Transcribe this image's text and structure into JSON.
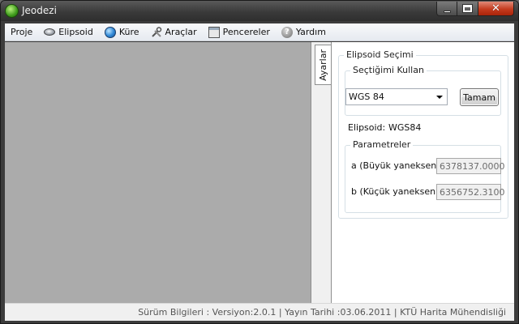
{
  "window": {
    "title": "Jeodezi"
  },
  "menu": {
    "items": [
      {
        "label": "Proje",
        "icon": ""
      },
      {
        "label": "Elipsoid",
        "icon": "ellipsoid-icon"
      },
      {
        "label": "Küre",
        "icon": "globe-icon"
      },
      {
        "label": "Araçlar",
        "icon": "tools-icon"
      },
      {
        "label": "Pencereler",
        "icon": "window-icon"
      },
      {
        "label": "Yardım",
        "icon": "help-icon"
      }
    ]
  },
  "panel": {
    "tab_label": "Ayarlar",
    "group_title": "Elipsoid Seçimi",
    "subgroup_title": "Seçtiğimi Kullan",
    "select_value": "WGS 84",
    "ok_button": "Tamam",
    "ellipsoid_label": "Elipsoid:",
    "ellipsoid_value": "WGS84",
    "params_title": "Parametreler",
    "a_label": "a (Büyük yaneksen) :",
    "a_value": "6378137.0000",
    "b_label": "b (Küçük yaneksen) :",
    "b_value": "6356752.3100"
  },
  "status": {
    "text": "Sürüm Bilgileri : Versiyon:2.0.1 | Yayın Tarihi :03.06.2011 | KTÜ Harita Mühendisliği"
  },
  "colors": {
    "close_button": "#c43b1e",
    "workspace": "#ababab",
    "titlebar": "#3a3a3a"
  }
}
